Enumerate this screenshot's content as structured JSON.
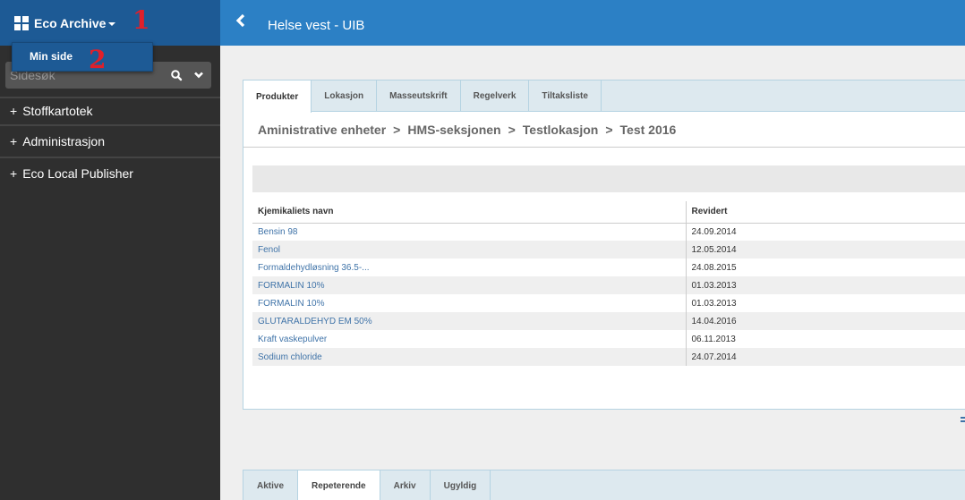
{
  "sidebar": {
    "brand": "Eco Archive",
    "dropdown_items": [
      "Min side"
    ],
    "search_placeholder": "Sidesøk",
    "nav_items": [
      {
        "label": "Stoffkartotek",
        "prefix": "+"
      },
      {
        "label": "Administrasjon",
        "prefix": "+"
      },
      {
        "label": "Eco Local Publisher",
        "prefix": "+"
      }
    ]
  },
  "annotations": {
    "one": "1",
    "two": "2"
  },
  "header": {
    "title": "Helse vest - UIB"
  },
  "main": {
    "tabs": [
      {
        "label": "Produkter",
        "active": true
      },
      {
        "label": "Lokasjon",
        "active": false
      },
      {
        "label": "Masseutskrift",
        "active": false
      },
      {
        "label": "Regelverk",
        "active": false
      },
      {
        "label": "Tiltaksliste",
        "active": false
      }
    ],
    "breadcrumb": [
      "Aministrative enheter",
      "HMS-seksjonen",
      "Testlokasjon",
      "Test 2016"
    ],
    "breadcrumb_separator": ">",
    "table": {
      "columns": [
        "Kjemikaliets navn",
        "Revidert"
      ],
      "rows": [
        {
          "name": "Bensin 98",
          "revised": "24.09.2014"
        },
        {
          "name": "Fenol",
          "revised": "12.05.2014"
        },
        {
          "name": "Formaldehydløsning 36.5-...",
          "revised": "24.08.2015"
        },
        {
          "name": "FORMALIN 10%",
          "revised": "01.03.2013"
        },
        {
          "name": "FORMALIN 10%",
          "revised": "01.03.2013"
        },
        {
          "name": "GLUTARALDEHYD EM 50%",
          "revised": "14.04.2016"
        },
        {
          "name": "Kraft vaskepulver",
          "revised": "06.11.2013"
        },
        {
          "name": "Sodium chloride",
          "revised": "24.07.2014"
        }
      ]
    }
  },
  "bottom": {
    "tabs": [
      {
        "label": "Aktive",
        "active": false
      },
      {
        "label": "Repeterende",
        "active": true
      },
      {
        "label": "Arkiv",
        "active": false
      },
      {
        "label": "Ugyldig",
        "active": false
      }
    ]
  },
  "colors": {
    "brand_bar": "#1d5a95",
    "top_bar": "#2c80c5",
    "sidebar": "#2f2f2f",
    "link": "#3f73a8",
    "tab_strip": "#dde9ef",
    "annotation": "#e0202a"
  }
}
